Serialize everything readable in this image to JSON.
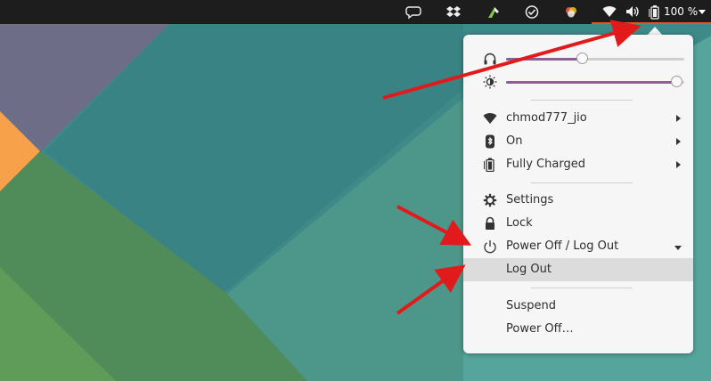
{
  "colors": {
    "topbar_bg": "#1d1d1d",
    "accent_underline": "#e95420",
    "menu_bg": "#f6f6f6",
    "slider_fill": "#8d5d9a",
    "highlight_bg": "#dcdcdc",
    "arrow_red": "#e11b1b"
  },
  "topbar": {
    "indicators": [
      "chat-bubble-icon",
      "dropbox-icon",
      "tool-icon",
      "check-circle-icon",
      "color-picker-icon"
    ],
    "status": {
      "wifi_icon": "wifi-icon",
      "volume_icon": "volume-icon",
      "battery_icon": "battery-icon",
      "battery_percent": "100 %"
    }
  },
  "menu": {
    "volume": {
      "icon": "headphones-icon",
      "level": 0.43
    },
    "brightness": {
      "icon": "brightness-icon",
      "level": 0.96
    },
    "network": {
      "icon": "wifi-icon",
      "label": "chmod777_jio"
    },
    "bluetooth": {
      "icon": "bluetooth-icon",
      "label": "On"
    },
    "battery": {
      "icon": "battery-icon",
      "label": "Fully Charged"
    },
    "settings": {
      "icon": "settings-icon",
      "label": "Settings"
    },
    "lock": {
      "icon": "lock-icon",
      "label": "Lock"
    },
    "power": {
      "icon": "power-icon",
      "label": "Power Off / Log Out",
      "expanded": true,
      "items": [
        {
          "label": "Log Out",
          "highlighted": true
        },
        {
          "label": "Suspend"
        },
        {
          "label": "Power Off…"
        }
      ]
    }
  }
}
